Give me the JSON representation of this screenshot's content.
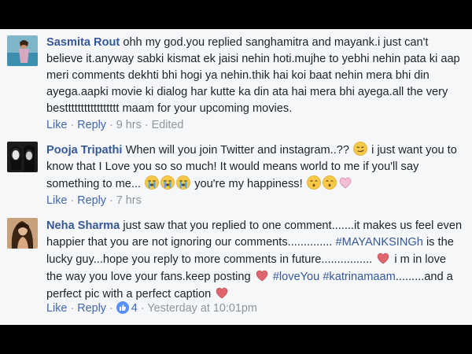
{
  "comments": [
    {
      "name": "Sasmita Rout",
      "text": "ohh my god.you replied sanghamitra and mayank.i just can't believe it.anyway sabki kismat ek jaisi nehin hoti.mujhe to yebhi nehin pata ki aap meri comments dekhti bhi hogi ya nehin.thik hai koi baat nehin mera bhi din ayega.aapki movie ki dialog har kutte ka din ata hai mera bhi ayega.all the very besttttttttttttttttt maam for your upcoming movies.",
      "like": "Like",
      "reply": "Reply",
      "time": "9 hrs",
      "edited": "Edited"
    },
    {
      "name": "Pooja Tripathi",
      "text_a": "When will you join Twitter and instagram..??",
      "text_b": "i just want you to know that I Love you so so much! It would means world to me if you'll say something to me...",
      "text_c": "you're my happiness!",
      "like": "Like",
      "reply": "Reply",
      "time": "7 hrs"
    },
    {
      "name": "Neha Sharma",
      "text_a": "just saw that you replied to one comment.......it makes us feel even happier that you are not ignoring our comments..............",
      "tag1": "#MAYANKSINGh",
      "text_b": "is the lucky guy...hope you reply to more comments in future................",
      "text_c": "i m in love the way you love your fans.keep posting",
      "tag2": "#loveYou",
      "tag3": "#katrinamaam",
      "text_d": ".........and a perfect pic with a perfect caption",
      "like": "Like",
      "reply": "Reply",
      "reaction_count": "4",
      "time": "Yesterday at 10:01pm"
    }
  ],
  "colors": {
    "name": "#365899",
    "link": "#4267b2",
    "meta": "#90949c",
    "heart": "#e0656c",
    "panel": "#f6f7f9"
  }
}
